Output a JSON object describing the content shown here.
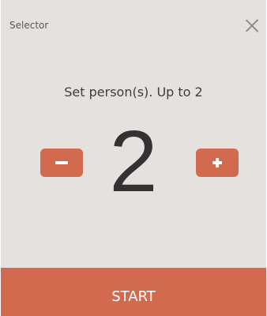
{
  "dialog": {
    "title": "Selector",
    "close_icon": "close-icon"
  },
  "selector": {
    "prompt": "Set person(s). Up to 2",
    "value": "2",
    "max": 2,
    "decrement_icon": "minus-icon",
    "increment_icon": "plus-icon"
  },
  "actions": {
    "start_label": "START"
  },
  "colors": {
    "background": "#e5e1df",
    "accent": "#d26a4f",
    "text": "#3f3c3c"
  }
}
